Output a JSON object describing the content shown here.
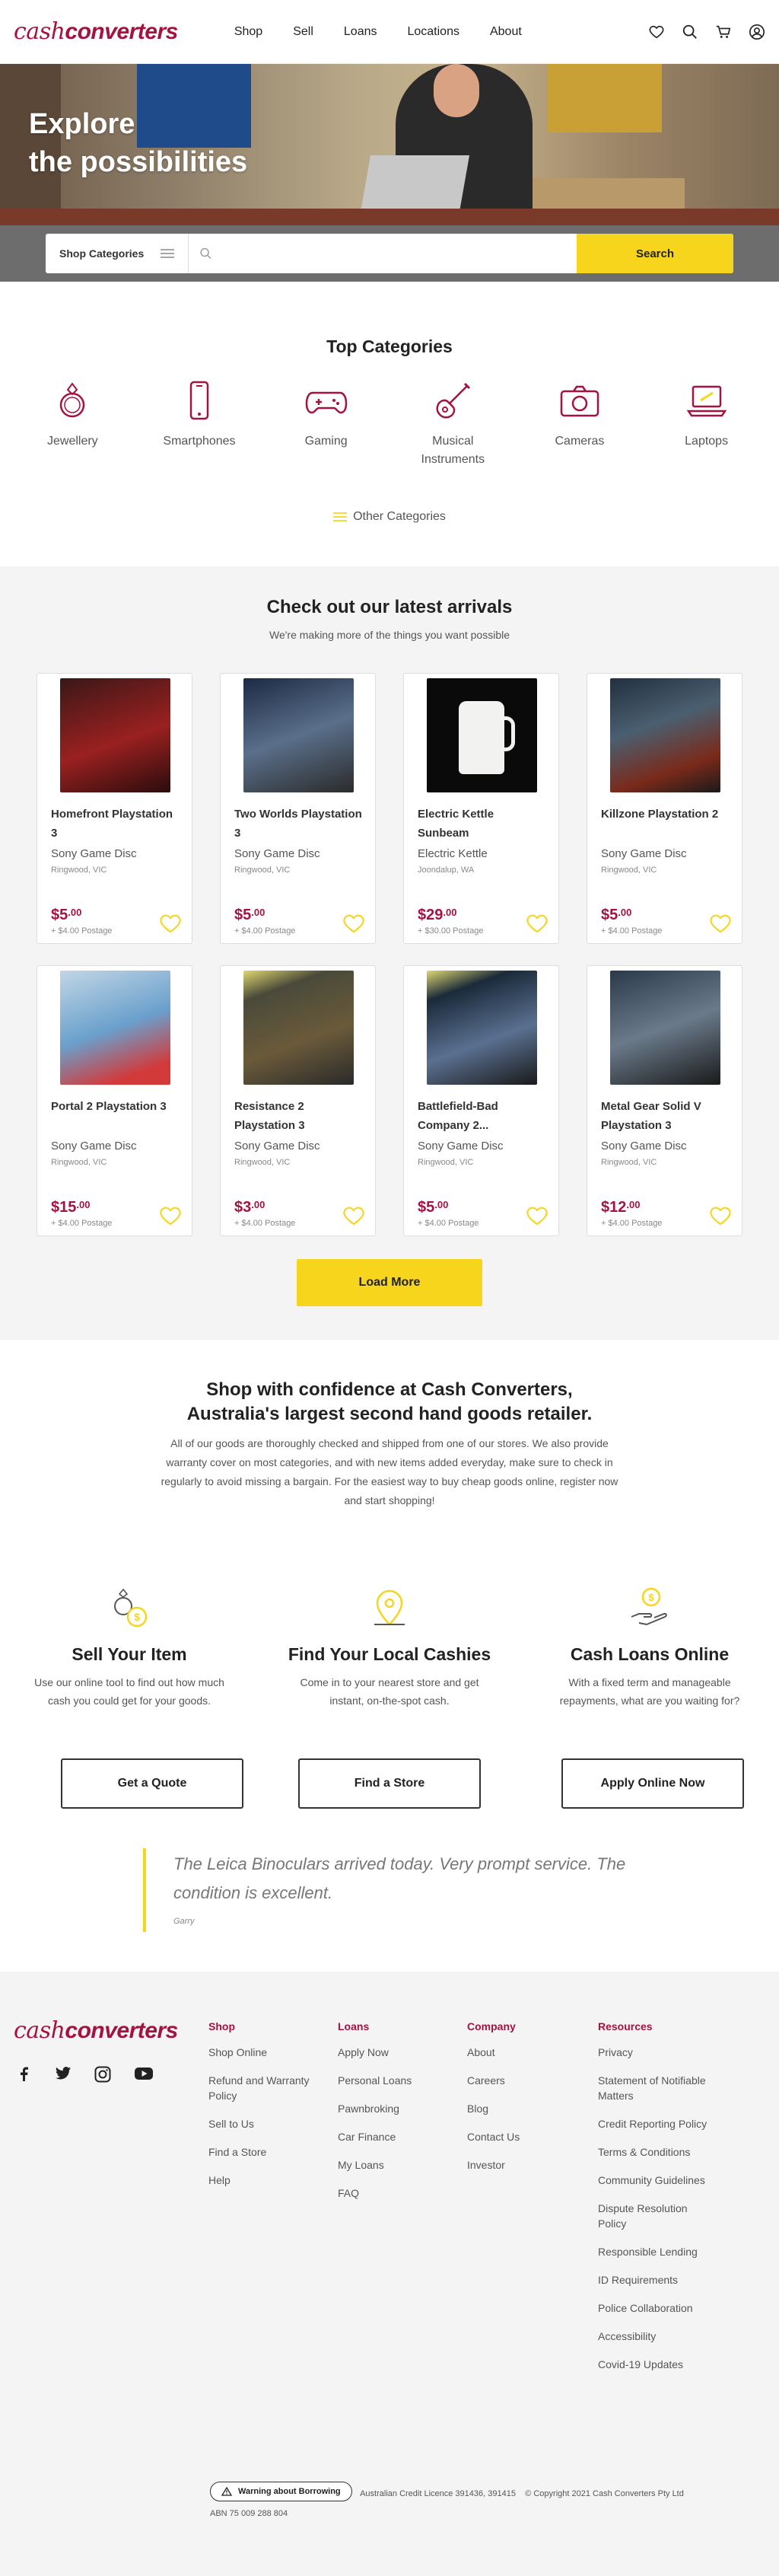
{
  "header": {
    "logo_part1": "cash",
    "logo_part2": "converters",
    "nav": [
      "Shop",
      "Sell",
      "Loans",
      "Locations",
      "About"
    ],
    "icons": [
      "heart-icon",
      "search-icon",
      "cart-icon",
      "user-icon"
    ]
  },
  "hero": {
    "line1": "Explore",
    "line2": "the possibilities"
  },
  "search": {
    "category_label": "Shop Categories",
    "placeholder": "",
    "button": "Search"
  },
  "top_categories": {
    "title": "Top Categories",
    "items": [
      {
        "label": "Jewellery",
        "icon": "ring-icon"
      },
      {
        "label": "Smartphones",
        "icon": "smartphone-icon"
      },
      {
        "label": "Gaming",
        "icon": "gamepad-icon"
      },
      {
        "label": "Musical Instruments",
        "icon": "guitar-icon"
      },
      {
        "label": "Cameras",
        "icon": "camera-icon"
      },
      {
        "label": "Laptops",
        "icon": "laptop-icon"
      }
    ],
    "other": "Other Categories"
  },
  "arrivals": {
    "title": "Check out our latest arrivals",
    "subtitle": "We're making more of the things you want possible",
    "products": [
      {
        "title": "Homefront Playstation 3",
        "condition": "Sony Game Disc",
        "location": "Ringwood, VIC",
        "price_main": "$5",
        "price_cents": ".00",
        "postage": "+ $4.00 Postage"
      },
      {
        "title": "Two Worlds Playstation 3",
        "condition": "Sony Game Disc",
        "location": "Ringwood, VIC",
        "price_main": "$5",
        "price_cents": ".00",
        "postage": "+ $4.00 Postage"
      },
      {
        "title": "Electric Kettle Sunbeam",
        "condition": "Electric Kettle",
        "location": "Joondalup, WA",
        "price_main": "$29",
        "price_cents": ".00",
        "postage": "+ $30.00 Postage"
      },
      {
        "title": "Killzone Playstation 2",
        "condition": "Sony Game Disc",
        "location": "Ringwood, VIC",
        "price_main": "$5",
        "price_cents": ".00",
        "postage": "+ $4.00 Postage"
      },
      {
        "title": "Portal 2 Playstation 3",
        "condition": "Sony Game Disc",
        "location": "Ringwood, VIC",
        "price_main": "$15",
        "price_cents": ".00",
        "postage": "+ $4.00 Postage"
      },
      {
        "title": "Resistance 2 Playstation 3",
        "condition": "Sony Game Disc",
        "location": "Ringwood, VIC",
        "price_main": "$3",
        "price_cents": ".00",
        "postage": "+ $4.00 Postage"
      },
      {
        "title": "Battlefield-Bad Company 2...",
        "condition": "Sony Game Disc",
        "location": "Ringwood, VIC",
        "price_main": "$5",
        "price_cents": ".00",
        "postage": "+ $4.00 Postage"
      },
      {
        "title": "Metal Gear Solid V Playstation 3",
        "condition": "Sony Game Disc",
        "location": "Ringwood, VIC",
        "price_main": "$12",
        "price_cents": ".00",
        "postage": "+ $4.00 Postage"
      }
    ],
    "load_more": "Load More"
  },
  "confidence": {
    "title_line1": "Shop with confidence at Cash Converters,",
    "title_line2": "Australia's largest second hand goods retailer.",
    "description": "All of our goods are thoroughly checked and shipped from one of our stores. We also provide warranty cover on most categories, and with new items added everyday, make sure to check in regularly to avoid missing a bargain. For the easiest way to buy cheap goods online, register now and start shopping!",
    "features": [
      {
        "title": "Sell Your Item",
        "text": "Use our online tool to find out how much cash you could get for your goods.",
        "button": "Get a Quote"
      },
      {
        "title": "Find Your Local Cashies",
        "text": "Come in to your nearest store and get instant, on-the-spot cash.",
        "button": "Find a Store"
      },
      {
        "title": "Cash Loans Online",
        "text": "With a fixed term and manageable repayments, what are you waiting for?",
        "button": "Apply Online Now"
      }
    ],
    "quote": "The Leica Binoculars arrived today. Very prompt service. The condition is excellent.",
    "quote_author": "Garry"
  },
  "footer": {
    "columns": [
      {
        "heading": "Shop",
        "links": [
          "Shop Online",
          "Refund and Warranty Policy",
          "Sell to Us",
          "Find a Store",
          "Help"
        ]
      },
      {
        "heading": "Loans",
        "links": [
          "Apply Now",
          "Personal Loans",
          "Pawnbroking",
          "Car Finance",
          "My Loans",
          "FAQ"
        ]
      },
      {
        "heading": "Company",
        "links": [
          "About",
          "Careers",
          "Blog",
          "Contact Us",
          "Investor"
        ]
      },
      {
        "heading": "Resources",
        "links": [
          "Privacy",
          "Statement of Notifiable Matters",
          "Credit Reporting Policy",
          "Terms & Conditions",
          "Community Guidelines",
          "Dispute Resolution Policy",
          "Responsible Lending",
          "ID Requirements",
          "Police Collaboration",
          "Accessibility",
          "Covid-19 Updates"
        ]
      }
    ],
    "warning_button": "Warning about Borrowing",
    "licence": "Australian Credit Licence 391436, 391415",
    "copyright": "© Copyright 2021 Cash Converters Pty Ltd",
    "abn": "ABN 75 009 288 804"
  },
  "colors": {
    "brand": "#a4123f",
    "accent": "#f7d51d"
  }
}
